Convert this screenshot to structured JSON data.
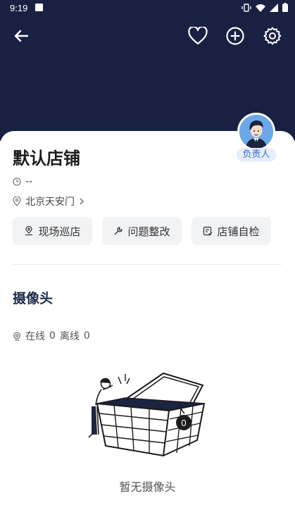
{
  "status_bar": {
    "time": "9:19"
  },
  "toolbar": {
    "back_icon": "arrow-left-icon",
    "favorite_icon": "heart-icon",
    "add_icon": "plus-circle-icon",
    "settings_icon": "gear-icon"
  },
  "store": {
    "name": "默认店铺",
    "hours": "--",
    "location": "北京天安门",
    "manager_label": "负责人"
  },
  "actions": [
    {
      "label": "现场巡店",
      "icon": "location-pin-icon"
    },
    {
      "label": "问题整改",
      "icon": "wrench-icon"
    },
    {
      "label": "店铺自检",
      "icon": "checklist-icon"
    }
  ],
  "camera_section": {
    "title": "摄像头",
    "online_label": "在线",
    "online_count": "0",
    "offline_label": "离线",
    "offline_count": "0",
    "badge_count": "0",
    "empty_text": "暂无摄像头"
  },
  "colors": {
    "header_bg": "#182142",
    "accent": "#3a6fd8"
  }
}
